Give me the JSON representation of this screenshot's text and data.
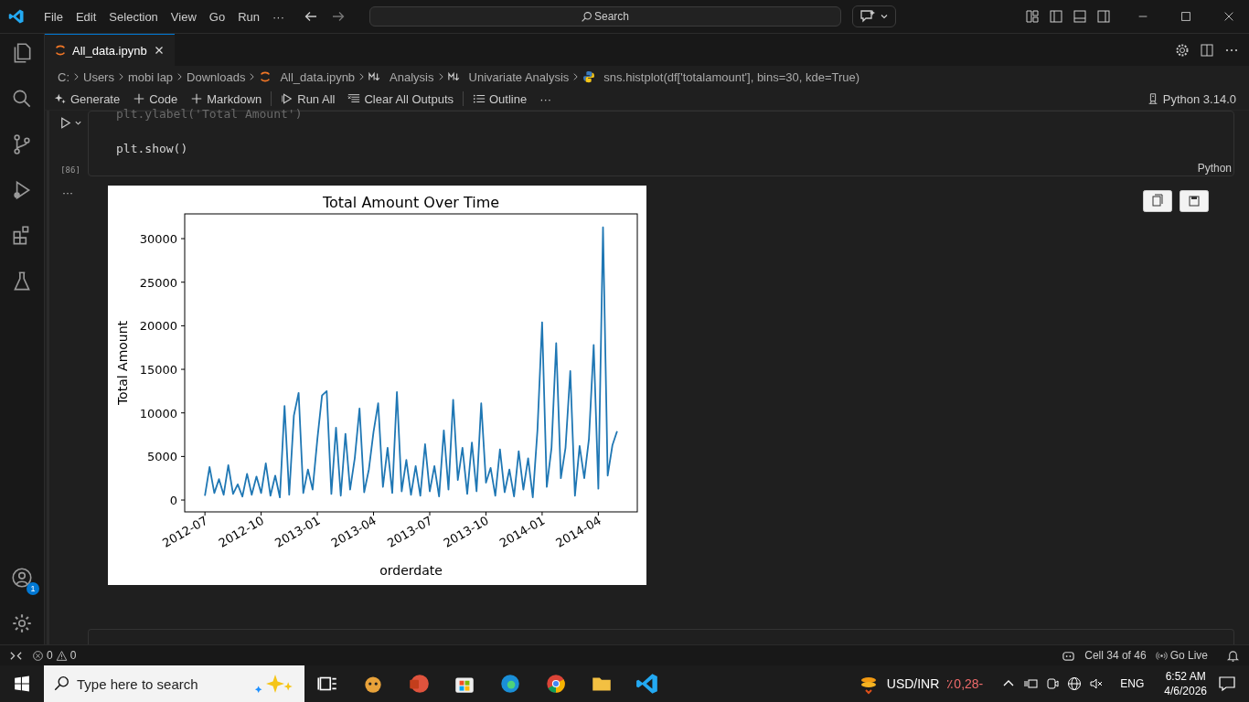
{
  "menu_bar": {
    "items": [
      "File",
      "Edit",
      "Selection",
      "View",
      "Go",
      "Run",
      "···"
    ],
    "search": {
      "placeholder": "Search"
    }
  },
  "activity_bar": {
    "account_badge": "1"
  },
  "tabs": [
    {
      "label": "All_data.ipynb",
      "selected": true
    }
  ],
  "breadcrumbs": [
    {
      "label": "C:",
      "kind": "folder"
    },
    {
      "label": "Users",
      "kind": "folder"
    },
    {
      "label": "mobi lap",
      "kind": "folder"
    },
    {
      "label": "Downloads",
      "kind": "folder"
    },
    {
      "label": "All_data.ipynb",
      "kind": "notebook"
    },
    {
      "label": "Analysis",
      "kind": "markdown"
    },
    {
      "label": "Univariate Analysis",
      "kind": "markdown"
    },
    {
      "label": "sns.histplot(df['totalamount'], bins=30, kde=True)",
      "kind": "python"
    }
  ],
  "toolbar": {
    "items": [
      {
        "label": "Generate",
        "kind": "sparkle"
      },
      {
        "label": "Code",
        "kind": "plus"
      },
      {
        "label": "Markdown",
        "kind": "plus"
      },
      {
        "label": "Run All",
        "kind": "run"
      },
      {
        "label": "Clear All Outputs",
        "kind": "clear"
      },
      {
        "label": "Outline",
        "kind": "list"
      },
      {
        "label": "···",
        "kind": "more"
      }
    ],
    "kernel": "Python 3.14.0"
  },
  "cell": {
    "lines": [
      "plt.ylabel('Total Amount')",
      "plt.show()"
    ],
    "execution_count": "[86]",
    "language": "Python",
    "output_marker": "···"
  },
  "output": {
    "chart_data": {
      "type": "line",
      "title": "Total Amount Over Time",
      "xlabel": "orderdate",
      "ylabel": "Total Amount",
      "categories": [
        "2012-07",
        null,
        null,
        null,
        null,
        null,
        null,
        null,
        null,
        null,
        null,
        null,
        "2012-10",
        null,
        null,
        null,
        null,
        null,
        null,
        null,
        null,
        null,
        null,
        null,
        "2013-01",
        null,
        null,
        null,
        null,
        null,
        null,
        null,
        null,
        null,
        null,
        null,
        "2013-04",
        null,
        null,
        null,
        null,
        null,
        null,
        null,
        null,
        null,
        null,
        null,
        "2013-07",
        null,
        null,
        null,
        null,
        null,
        null,
        null,
        null,
        null,
        null,
        null,
        "2013-10",
        null,
        null,
        null,
        null,
        null,
        null,
        null,
        null,
        null,
        null,
        null,
        "2014-01",
        null,
        null,
        null,
        null,
        null,
        null,
        null,
        null,
        null,
        null,
        null,
        "2014-04",
        null,
        null,
        null,
        null
      ],
      "ylim": [
        -1360,
        32840
      ],
      "yticks": [
        0,
        5000,
        10000,
        15000,
        20000,
        25000,
        30000
      ],
      "series": [
        {
          "color": "#1f77b4",
          "values": [
            500,
            3800,
            800,
            2400,
            600,
            4000,
            700,
            1800,
            400,
            3000,
            600,
            2700,
            800,
            4200,
            500,
            2800,
            300,
            10800,
            600,
            9700,
            12300,
            800,
            3500,
            1200,
            7000,
            12000,
            12500,
            700,
            8300,
            500,
            7600,
            1200,
            4800,
            10500,
            900,
            3500,
            7800,
            11100,
            1500,
            6000,
            800,
            12400,
            1000,
            4600,
            600,
            3900,
            500,
            6400,
            1000,
            3900,
            400,
            8000,
            1200,
            11500,
            2300,
            6000,
            700,
            6600,
            1000,
            11100,
            2000,
            3700,
            500,
            5800,
            900,
            3500,
            400,
            5600,
            1200,
            4800,
            300,
            8000,
            20400,
            1500,
            6000,
            18000,
            2500,
            6000,
            14800,
            500,
            6200,
            2500,
            7000,
            17800,
            1300,
            31300,
            2800,
            6300,
            7900
          ]
        }
      ]
    }
  },
  "status_bar": {
    "errors": "0",
    "warnings": "0",
    "cell_position": "Cell 34 of 46",
    "go_live": "Go Live"
  },
  "taskbar": {
    "search_placeholder": "Type here to search",
    "ticker": "USD/INR",
    "ticker_change": "٪0,28-",
    "language": "ENG",
    "time": "6:52 AM",
    "date": "4/6/2026"
  }
}
